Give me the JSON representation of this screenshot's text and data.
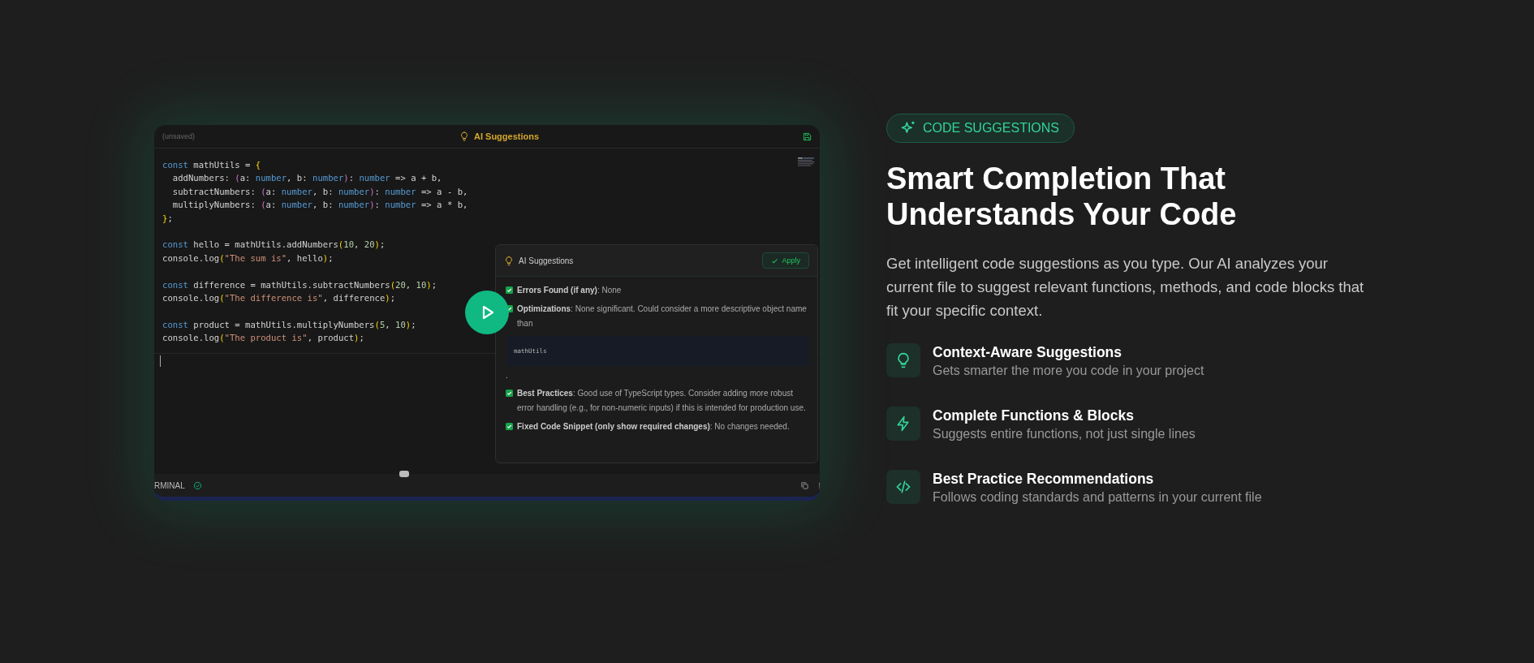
{
  "editor": {
    "file_status": "(unsaved)",
    "title": "AI Suggestions",
    "code_blocks": [
      {
        "lines": [
          [
            {
              "t": "const",
              "kind": "kw"
            },
            {
              "t": " mathUtils = ",
              "kind": "id"
            },
            {
              "t": "{",
              "kind": "br"
            }
          ],
          [
            {
              "t": "  addNumbers: ",
              "kind": "id"
            },
            {
              "t": "(",
              "kind": "pa"
            },
            {
              "t": "a: ",
              "kind": "id"
            },
            {
              "t": "number",
              "kind": "ty"
            },
            {
              "t": ", b: ",
              "kind": "id"
            },
            {
              "t": "number",
              "kind": "ty"
            },
            {
              "t": ")",
              "kind": "pa"
            },
            {
              "t": ": ",
              "kind": "id"
            },
            {
              "t": "number",
              "kind": "ty"
            },
            {
              "t": " => a + b,",
              "kind": "id"
            }
          ],
          [
            {
              "t": "  subtractNumbers: ",
              "kind": "id"
            },
            {
              "t": "(",
              "kind": "pa"
            },
            {
              "t": "a: ",
              "kind": "id"
            },
            {
              "t": "number",
              "kind": "ty"
            },
            {
              "t": ", b: ",
              "kind": "id"
            },
            {
              "t": "number",
              "kind": "ty"
            },
            {
              "t": ")",
              "kind": "pa"
            },
            {
              "t": ": ",
              "kind": "id"
            },
            {
              "t": "number",
              "kind": "ty"
            },
            {
              "t": " => a - b,",
              "kind": "id"
            }
          ],
          [
            {
              "t": "  multiplyNumbers: ",
              "kind": "id"
            },
            {
              "t": "(",
              "kind": "pa"
            },
            {
              "t": "a: ",
              "kind": "id"
            },
            {
              "t": "number",
              "kind": "ty"
            },
            {
              "t": ", b: ",
              "kind": "id"
            },
            {
              "t": "number",
              "kind": "ty"
            },
            {
              "t": ")",
              "kind": "pa"
            },
            {
              "t": ": ",
              "kind": "id"
            },
            {
              "t": "number",
              "kind": "ty"
            },
            {
              "t": " => a * b,",
              "kind": "id"
            }
          ],
          [
            {
              "t": "}",
              "kind": "br"
            },
            {
              "t": ";",
              "kind": "id"
            }
          ]
        ]
      },
      {
        "lines": [
          [
            {
              "t": "const",
              "kind": "kw"
            },
            {
              "t": " hello = mathUtils.addNumbers",
              "kind": "id"
            },
            {
              "t": "(",
              "kind": "br"
            },
            {
              "t": "10",
              "kind": "nu"
            },
            {
              "t": ", ",
              "kind": "id"
            },
            {
              "t": "20",
              "kind": "nu"
            },
            {
              "t": ")",
              "kind": "br"
            },
            {
              "t": ";",
              "kind": "id"
            }
          ],
          [
            {
              "t": "console.log",
              "kind": "id"
            },
            {
              "t": "(",
              "kind": "br"
            },
            {
              "t": "\"The sum is\"",
              "kind": "st"
            },
            {
              "t": ", hello",
              "kind": "id"
            },
            {
              "t": ")",
              "kind": "br"
            },
            {
              "t": ";",
              "kind": "id"
            }
          ]
        ]
      },
      {
        "lines": [
          [
            {
              "t": "const",
              "kind": "kw"
            },
            {
              "t": " difference = mathUtils.subtractNumbers",
              "kind": "id"
            },
            {
              "t": "(",
              "kind": "br"
            },
            {
              "t": "20",
              "kind": "nu"
            },
            {
              "t": ", ",
              "kind": "id"
            },
            {
              "t": "10",
              "kind": "nu"
            },
            {
              "t": ")",
              "kind": "br"
            },
            {
              "t": ";",
              "kind": "id"
            }
          ],
          [
            {
              "t": "console.log",
              "kind": "id"
            },
            {
              "t": "(",
              "kind": "br"
            },
            {
              "t": "\"The difference is\"",
              "kind": "st"
            },
            {
              "t": ", difference",
              "kind": "id"
            },
            {
              "t": ")",
              "kind": "br"
            },
            {
              "t": ";",
              "kind": "id"
            }
          ]
        ]
      },
      {
        "lines": [
          [
            {
              "t": "const",
              "kind": "kw"
            },
            {
              "t": " product = mathUtils.multiplyNumbers",
              "kind": "id"
            },
            {
              "t": "(",
              "kind": "br"
            },
            {
              "t": "5",
              "kind": "nu"
            },
            {
              "t": ", ",
              "kind": "id"
            },
            {
              "t": "10",
              "kind": "nu"
            },
            {
              "t": ")",
              "kind": "br"
            },
            {
              "t": ";",
              "kind": "id"
            }
          ],
          [
            {
              "t": "console.log",
              "kind": "id"
            },
            {
              "t": "(",
              "kind": "br"
            },
            {
              "t": "\"The product is\"",
              "kind": "st"
            },
            {
              "t": ", product",
              "kind": "id"
            },
            {
              "t": ")",
              "kind": "br"
            },
            {
              "t": ";",
              "kind": "id"
            }
          ]
        ]
      }
    ],
    "popup": {
      "title": "AI Suggestions",
      "apply": "Apply",
      "items": [
        {
          "checked": true,
          "label": "Errors Found (if any)",
          "text": ": None"
        },
        {
          "checked": true,
          "label": "Optimizations",
          "text": ": None significant. Could consider a more descriptive object name than",
          "code": "mathUtils",
          "after": "."
        },
        {
          "checked": true,
          "label": "Best Practices",
          "text": ": Good use of TypeScript types. Consider adding more robust error handling (e.g., for non-numeric inputs) if this is intended for production use."
        },
        {
          "checked": true,
          "label": "Fixed Code Snippet (only show required changes)",
          "text": ": No changes needed."
        }
      ]
    },
    "panel_tab": "RMINAL"
  },
  "badge": "CODE SUGGESTIONS",
  "heading": "Smart Completion That Understands Your Code",
  "description": "Get intelligent code suggestions as you type. Our AI analyzes your current file to suggest relevant functions, methods, and code blocks that fit your specific context.",
  "features": [
    {
      "kind": "bulb",
      "title": "Context-Aware Suggestions",
      "text": "Gets smarter the more you code in your project"
    },
    {
      "kind": "bolt",
      "title": "Complete Functions & Blocks",
      "text": "Suggests entire functions, not just single lines"
    },
    {
      "kind": "code",
      "title": "Best Practice Recommendations",
      "text": "Follows coding standards and patterns in your current file"
    }
  ]
}
